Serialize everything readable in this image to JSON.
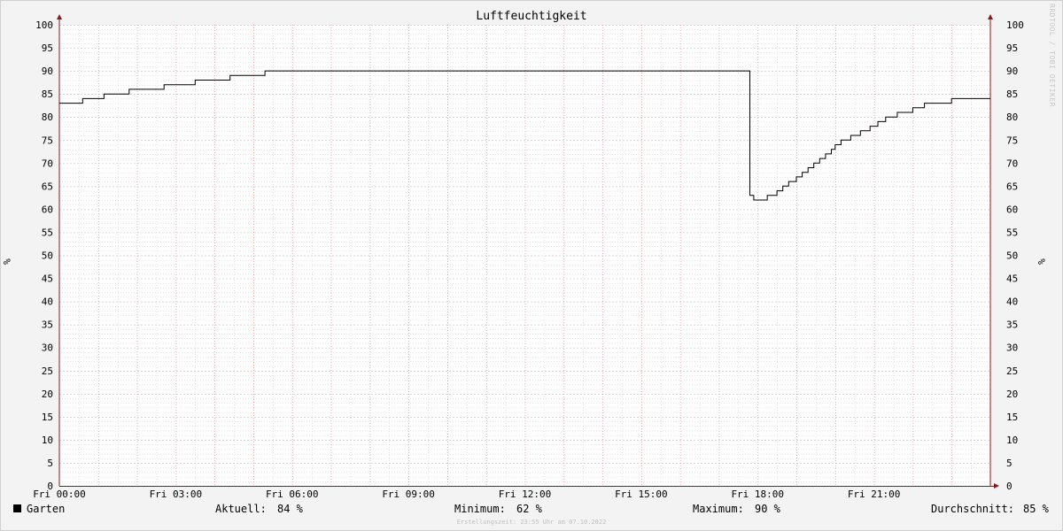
{
  "chart_data": {
    "type": "line",
    "title": "Luftfeuchtigkeit",
    "ylabel_left": "%",
    "ylabel_right": "%",
    "ylim": [
      0,
      100
    ],
    "xlim": [
      0,
      24
    ],
    "y_ticks": [
      0,
      5,
      10,
      15,
      20,
      25,
      30,
      35,
      40,
      45,
      50,
      55,
      60,
      65,
      70,
      75,
      80,
      85,
      90,
      95,
      100
    ],
    "x_ticks": [
      {
        "x": 0,
        "label": "Fri 00:00"
      },
      {
        "x": 3,
        "label": "Fri 03:00"
      },
      {
        "x": 6,
        "label": "Fri 06:00"
      },
      {
        "x": 9,
        "label": "Fri 09:00"
      },
      {
        "x": 12,
        "label": "Fri 12:00"
      },
      {
        "x": 15,
        "label": "Fri 15:00"
      },
      {
        "x": 18,
        "label": "Fri 18:00"
      },
      {
        "x": 21,
        "label": "Fri 21:00"
      }
    ],
    "grid": true,
    "series": [
      {
        "name": "Garten",
        "color": "#000000",
        "step": true,
        "points": [
          [
            0.0,
            83
          ],
          [
            0.6,
            84
          ],
          [
            1.15,
            85
          ],
          [
            1.8,
            86
          ],
          [
            2.7,
            87
          ],
          [
            3.5,
            88
          ],
          [
            4.4,
            89
          ],
          [
            5.3,
            90
          ],
          [
            17.8,
            63
          ],
          [
            17.9,
            62
          ],
          [
            18.25,
            63
          ],
          [
            18.5,
            64
          ],
          [
            18.65,
            65
          ],
          [
            18.8,
            66
          ],
          [
            19.0,
            67
          ],
          [
            19.15,
            68
          ],
          [
            19.3,
            69
          ],
          [
            19.45,
            70
          ],
          [
            19.6,
            71
          ],
          [
            19.75,
            72
          ],
          [
            19.9,
            73
          ],
          [
            20.0,
            74
          ],
          [
            20.15,
            75
          ],
          [
            20.4,
            76
          ],
          [
            20.65,
            77
          ],
          [
            20.9,
            78
          ],
          [
            21.1,
            79
          ],
          [
            21.3,
            80
          ],
          [
            21.6,
            81
          ],
          [
            22.0,
            82
          ],
          [
            22.3,
            83
          ],
          [
            23.0,
            84
          ],
          [
            24.0,
            84
          ]
        ]
      }
    ]
  },
  "legend": {
    "series_name": "Garten",
    "current_label": "Aktuell:",
    "current_value": "84 %",
    "min_label": "Minimum:",
    "min_value": "62 %",
    "max_label": "Maximum:",
    "max_value": "90 %",
    "avg_label": "Durchschnitt:",
    "avg_value": "85 %"
  },
  "watermark": "RRDTOOL / TOBI OETIKER",
  "footer": "Erstellungszeit: 23:55 Uhr am 07.10.2022",
  "colors": {
    "background": "#f3f3f3",
    "plot_background": "#ffffff",
    "minor_grid": "#c8c8c8",
    "major_grid": "#e38b96",
    "axis": "#8b1a1a",
    "line": "#000000"
  }
}
